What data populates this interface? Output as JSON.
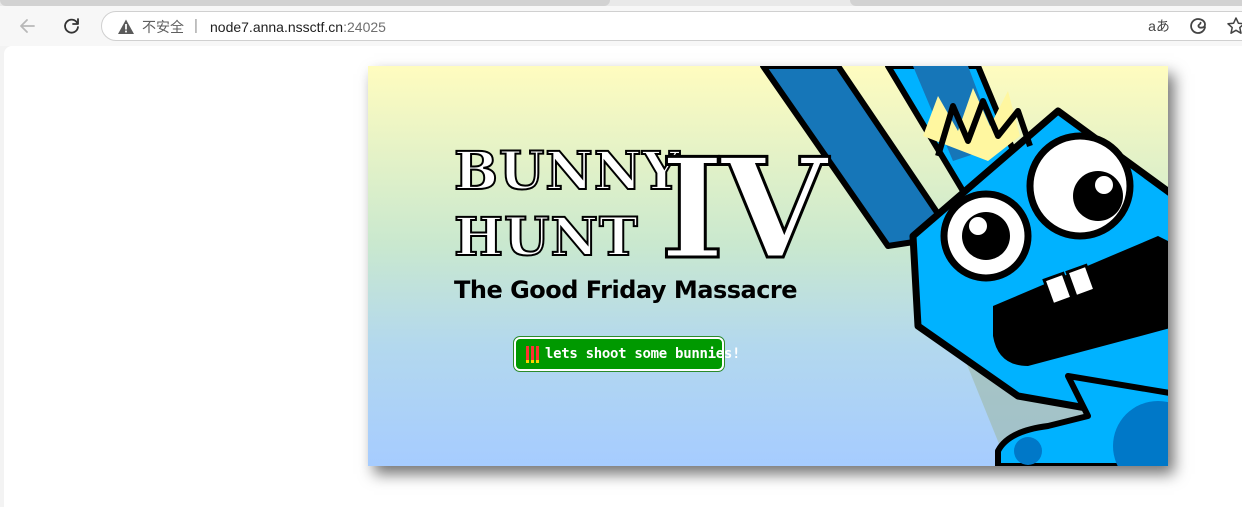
{
  "browser": {
    "security_label": "不安全",
    "separator": "|",
    "url_host": "node7.anna.nssctf.cn",
    "url_port": ":24025",
    "read_aloud_label": "aあ"
  },
  "icons": [
    "back-arrow-icon",
    "reload-icon",
    "warning-icon",
    "read-aloud-icon",
    "edge-copilot-icon",
    "favorite-star-icon",
    "ammo-icon"
  ],
  "game": {
    "title_line1": "BUNNY",
    "title_line2": "HUNT",
    "title_numeral": "IV",
    "subtitle": "The Good Friday Massacre",
    "start_button_label": "lets shoot some bunnies!",
    "colors": {
      "sky_top": "#fffcbf",
      "sky_bottom": "#a6ccff",
      "bunny_blue": "#00b2ff",
      "bunny_dark_blue": "#0078c8",
      "button_green": "#009900"
    }
  }
}
